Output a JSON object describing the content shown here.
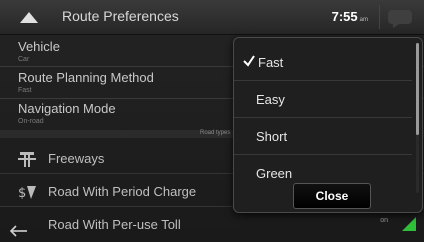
{
  "header": {
    "title": "Route Preferences",
    "time": "7:55",
    "ampm": "am"
  },
  "settings": [
    {
      "label": "Vehicle",
      "value": "Car"
    },
    {
      "label": "Route Planning Method",
      "value": "Fast"
    },
    {
      "label": "Navigation Mode",
      "value": "On-road"
    }
  ],
  "section_tag": "Road types",
  "road_types": [
    {
      "label": "Freeways"
    },
    {
      "label": "Road With Period Charge"
    },
    {
      "label": "Road With Per-use Toll",
      "status": "on"
    }
  ],
  "dropdown": {
    "options": [
      "Fast",
      "Easy",
      "Short",
      "Green"
    ],
    "selected": "Fast",
    "close_label": "Close"
  },
  "colors": {
    "accent_green": "#2fbf3a",
    "background": "#1b1b1b"
  },
  "icons": {
    "back": "triangle-up-icon",
    "bottom_back": "arrow-left-icon",
    "freeway": "freeway-icon",
    "toll": "toll-icon",
    "chat": "speech-bubble-icon"
  }
}
